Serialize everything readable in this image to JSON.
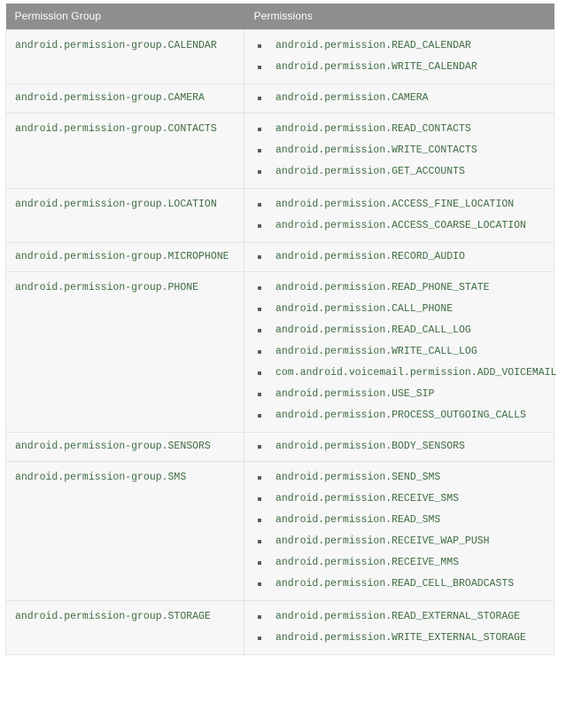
{
  "table": {
    "headers": {
      "group": "Permission Group",
      "permissions": "Permissions"
    },
    "colors": {
      "header_background": "#8e8e8e",
      "header_text": "#ffffff",
      "cell_background": "#f7f7f7",
      "cell_border": "#e3e3e3",
      "mono_text": "#3d6b42",
      "bullet": "#5b5b5b"
    },
    "rows": [
      {
        "group": "android.permission-group.CALENDAR",
        "permissions": [
          "android.permission.READ_CALENDAR",
          "android.permission.WRITE_CALENDAR"
        ]
      },
      {
        "group": "android.permission-group.CAMERA",
        "permissions": [
          "android.permission.CAMERA"
        ]
      },
      {
        "group": "android.permission-group.CONTACTS",
        "permissions": [
          "android.permission.READ_CONTACTS",
          "android.permission.WRITE_CONTACTS",
          "android.permission.GET_ACCOUNTS"
        ]
      },
      {
        "group": "android.permission-group.LOCATION",
        "permissions": [
          "android.permission.ACCESS_FINE_LOCATION",
          "android.permission.ACCESS_COARSE_LOCATION"
        ]
      },
      {
        "group": "android.permission-group.MICROPHONE",
        "permissions": [
          "android.permission.RECORD_AUDIO"
        ]
      },
      {
        "group": "android.permission-group.PHONE",
        "permissions": [
          "android.permission.READ_PHONE_STATE",
          "android.permission.CALL_PHONE",
          "android.permission.READ_CALL_LOG",
          "android.permission.WRITE_CALL_LOG",
          "com.android.voicemail.permission.ADD_VOICEMAIL",
          "android.permission.USE_SIP",
          "android.permission.PROCESS_OUTGOING_CALLS"
        ]
      },
      {
        "group": "android.permission-group.SENSORS",
        "permissions": [
          "android.permission.BODY_SENSORS"
        ]
      },
      {
        "group": "android.permission-group.SMS",
        "permissions": [
          "android.permission.SEND_SMS",
          "android.permission.RECEIVE_SMS",
          "android.permission.READ_SMS",
          "android.permission.RECEIVE_WAP_PUSH",
          "android.permission.RECEIVE_MMS",
          "android.permission.READ_CELL_BROADCASTS"
        ]
      },
      {
        "group": "android.permission-group.STORAGE",
        "permissions": [
          "android.permission.READ_EXTERNAL_STORAGE",
          "android.permission.WRITE_EXTERNAL_STORAGE"
        ]
      }
    ]
  }
}
